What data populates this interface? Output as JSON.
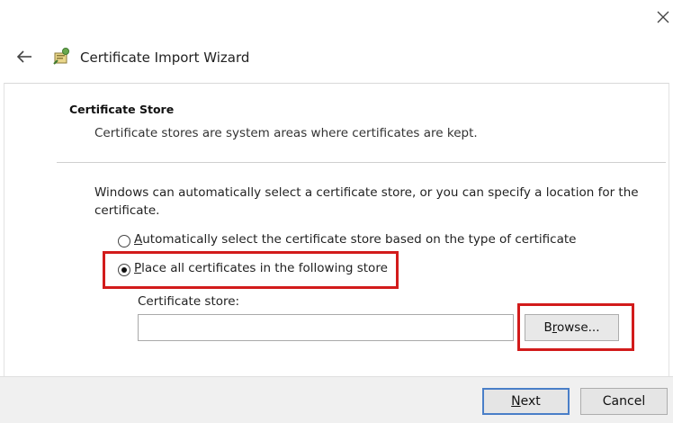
{
  "window": {
    "title": "Certificate Import Wizard",
    "close_icon": "close-icon",
    "back_icon": "back-arrow-icon",
    "app_icon": "certificate-wizard-icon"
  },
  "page": {
    "heading": "Certificate Store",
    "description": "Certificate stores are system areas where certificates are kept.",
    "intro": "Windows can automatically select a certificate store, or you can specify a location for the certificate."
  },
  "options": {
    "auto": {
      "mnemonic": "A",
      "label_rest": "utomatically select the certificate store based on the type of certificate",
      "selected": false
    },
    "place": {
      "mnemonic": "P",
      "label_rest": "lace all certificates in the following store",
      "selected": true
    }
  },
  "store": {
    "label": "Certificate store:",
    "value": "",
    "browse_mnemonic": "r",
    "browse_before": "B",
    "browse_after": "owse..."
  },
  "footer": {
    "next_mnemonic": "N",
    "next_rest": "ext",
    "cancel_label": "Cancel"
  },
  "colors": {
    "highlight": "#d21b1b",
    "default_button_border": "#4a7fc8",
    "footer_bg": "#f0f0f0"
  }
}
